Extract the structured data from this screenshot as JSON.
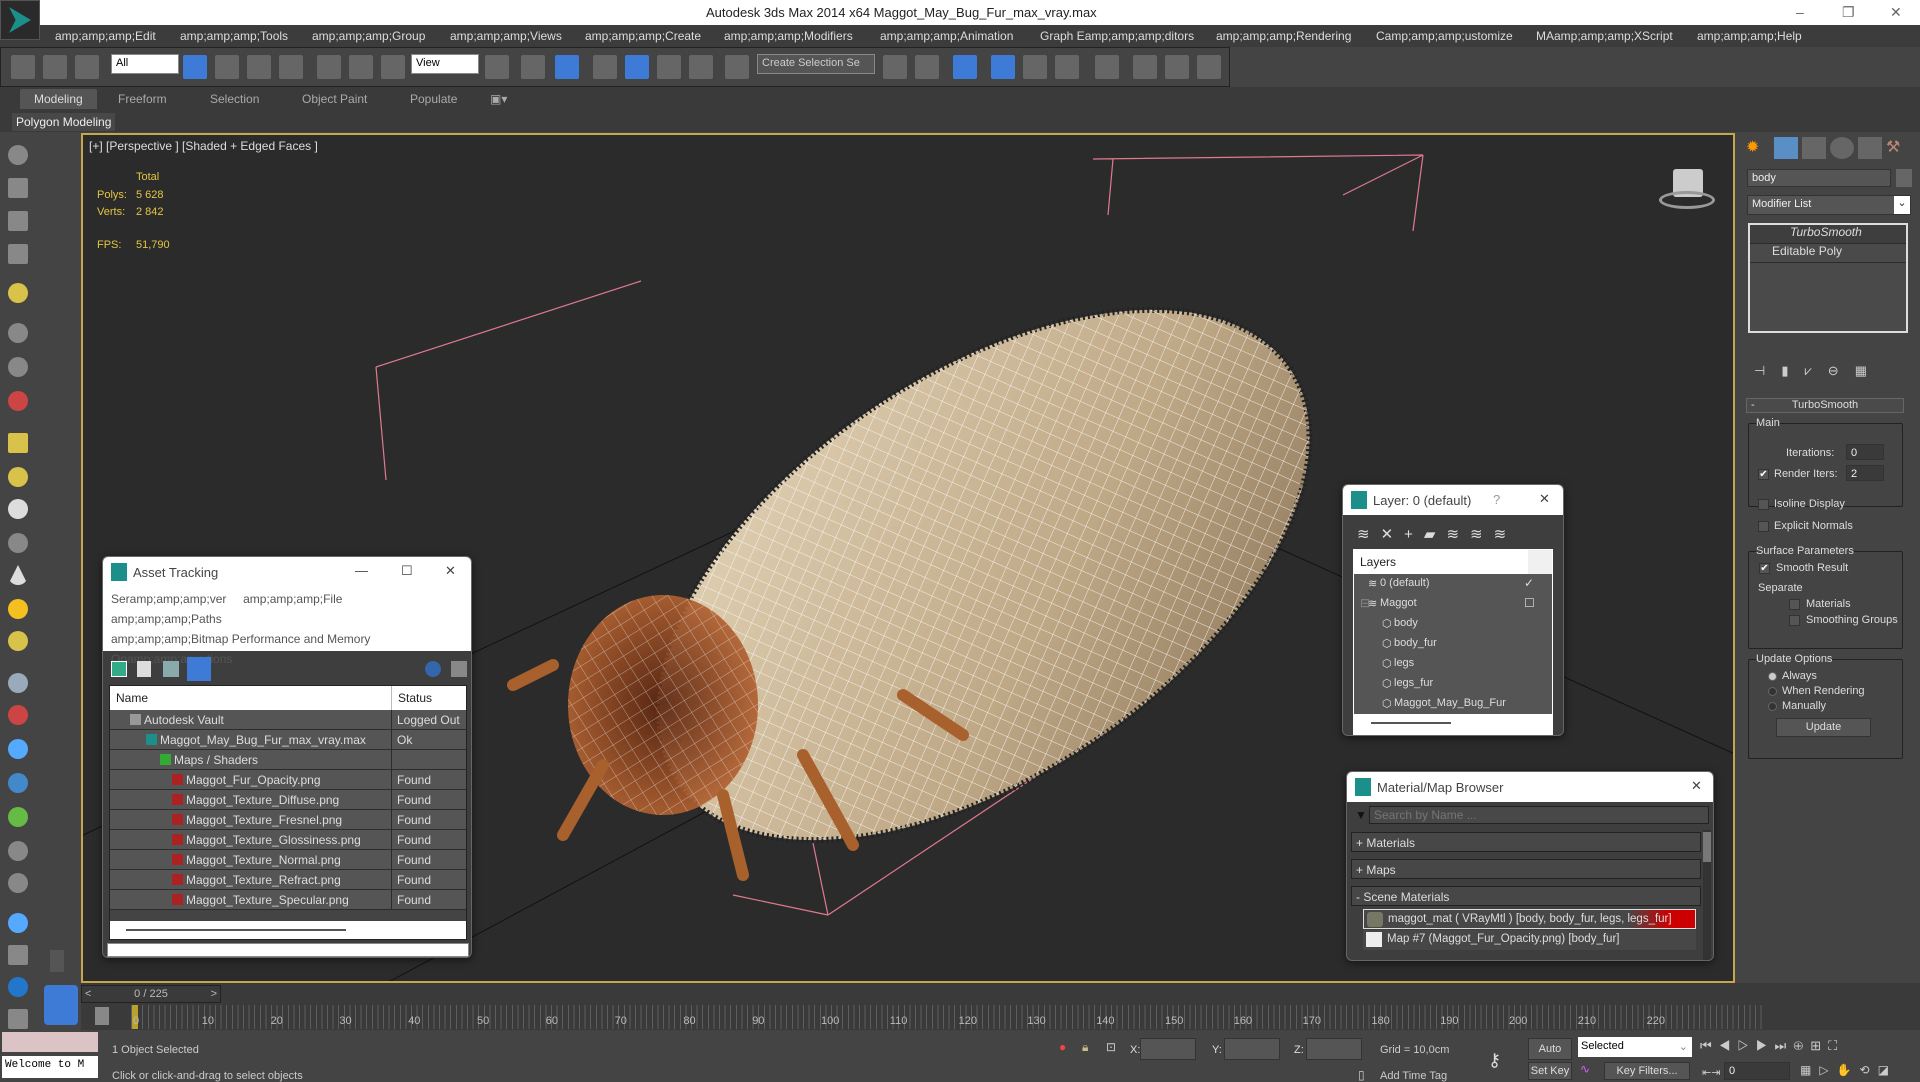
{
  "app": {
    "title": "Autodesk 3ds Max  2014 x64    Maggot_May_Bug_Fur_max_vray.max"
  },
  "menu": [
    "amp;amp;amp;Edit",
    "amp;amp;amp;Tools",
    "amp;amp;amp;Group",
    "amp;amp;amp;Views",
    "amp;amp;amp;Create",
    "amp;amp;amp;Modifiers",
    "amp;amp;amp;Animation",
    "Graph Eamp;amp;amp;ditors",
    "amp;amp;amp;Rendering",
    "Camp;amp;amp;ustomize",
    "MAamp;amp;amp;XScript",
    "amp;amp;amp;Help"
  ],
  "toolbar": {
    "filter": "All",
    "refcoord": "View",
    "selection_set": "Create Selection Se"
  },
  "ribbon": {
    "tabs": [
      "Modeling",
      "Freeform",
      "Selection",
      "Object Paint",
      "Populate"
    ],
    "panel": "Polygon Modeling"
  },
  "viewport": {
    "label": "[+] [Perspective ] [Shaded + Edged Faces ]",
    "total": "Total",
    "polys_label": "Polys:",
    "polys": "5 628",
    "verts_label": "Verts:",
    "verts": "2 842",
    "fps_label": "FPS:",
    "fps": "51,790"
  },
  "command_panel": {
    "object_name": "body",
    "modifier_list": "Modifier List",
    "stack": [
      "TurboSmooth",
      "Editable Poly"
    ],
    "rollout": "TurboSmooth",
    "main": "Main",
    "iterations_label": "Iterations:",
    "iterations": "0",
    "render_iters_label": "Render Iters:",
    "render_iters": "2",
    "render_iters_checked": true,
    "isoline": "Isoline Display",
    "explicit_normals": "Explicit Normals",
    "surface_params": "Surface Parameters",
    "smooth_result": "Smooth Result",
    "separate": "Separate",
    "materials": "Materials",
    "smoothing_groups": "Smoothing Groups",
    "update_options": "Update Options",
    "always": "Always",
    "when_rendering": "When Rendering",
    "manually": "Manually",
    "update": "Update"
  },
  "asset_tracking": {
    "title": "Asset Tracking",
    "menu": [
      "Seramp;amp;amp;ver",
      "amp;amp;amp;File",
      "amp;amp;amp;Paths",
      "amp;amp;amp;Bitmap Performance and Memory",
      "Opamp;amp;amp;tions"
    ],
    "columns": [
      "Name",
      "Status"
    ],
    "rows": [
      {
        "name": "Autodesk Vault",
        "status": "Logged Out ..."
      },
      {
        "name": "Maggot_May_Bug_Fur_max_vray.max",
        "status": "Ok"
      },
      {
        "name": "Maps / Shaders",
        "status": ""
      },
      {
        "name": "Maggot_Fur_Opacity.png",
        "status": "Found"
      },
      {
        "name": "Maggot_Texture_Diffuse.png",
        "status": "Found"
      },
      {
        "name": "Maggot_Texture_Fresnel.png",
        "status": "Found"
      },
      {
        "name": "Maggot_Texture_Glossiness.png",
        "status": "Found"
      },
      {
        "name": "Maggot_Texture_Normal.png",
        "status": "Found"
      },
      {
        "name": "Maggot_Texture_Refract.png",
        "status": "Found"
      },
      {
        "name": "Maggot_Texture_Specular.png",
        "status": "Found"
      }
    ]
  },
  "layer_dialog": {
    "title": "Layer: 0 (default)",
    "help": "?",
    "header": "Layers",
    "layers": [
      "0 (default)",
      "Maggot",
      "body",
      "body_fur",
      "legs",
      "legs_fur",
      "Maggot_May_Bug_Fur"
    ]
  },
  "material_browser": {
    "title": "Material/Map Browser",
    "search_placeholder": "Search by Name ...",
    "groups": [
      "+ Materials",
      "+ Maps",
      "- Scene Materials"
    ],
    "items": [
      "maggot_mat ( VRayMtl ) [body, body_fur, legs, legs_fur]",
      "Map #7 (Maggot_Fur_Opacity.png) [body_fur]"
    ]
  },
  "timeline": {
    "frame": "0 / 225",
    "ticks": [
      "0",
      "10",
      "20",
      "30",
      "40",
      "50",
      "60",
      "70",
      "80",
      "90",
      "100",
      "110",
      "120",
      "130",
      "140",
      "150",
      "160",
      "170",
      "180",
      "190",
      "200",
      "210",
      "220"
    ]
  },
  "status": {
    "selected": "1 Object Selected",
    "prompt": "Click or click-and-drag to select objects",
    "welcome": "Welcome to M",
    "x": "X:",
    "y": "Y:",
    "z": "Z:",
    "grid": "Grid = 10,0cm",
    "add_time_tag": "Add Time Tag",
    "auto_key": "Auto Key",
    "set_key": "Set Key",
    "key_mode": "Selected",
    "key_filters": "Key Filters...",
    "current_frame": "0"
  }
}
